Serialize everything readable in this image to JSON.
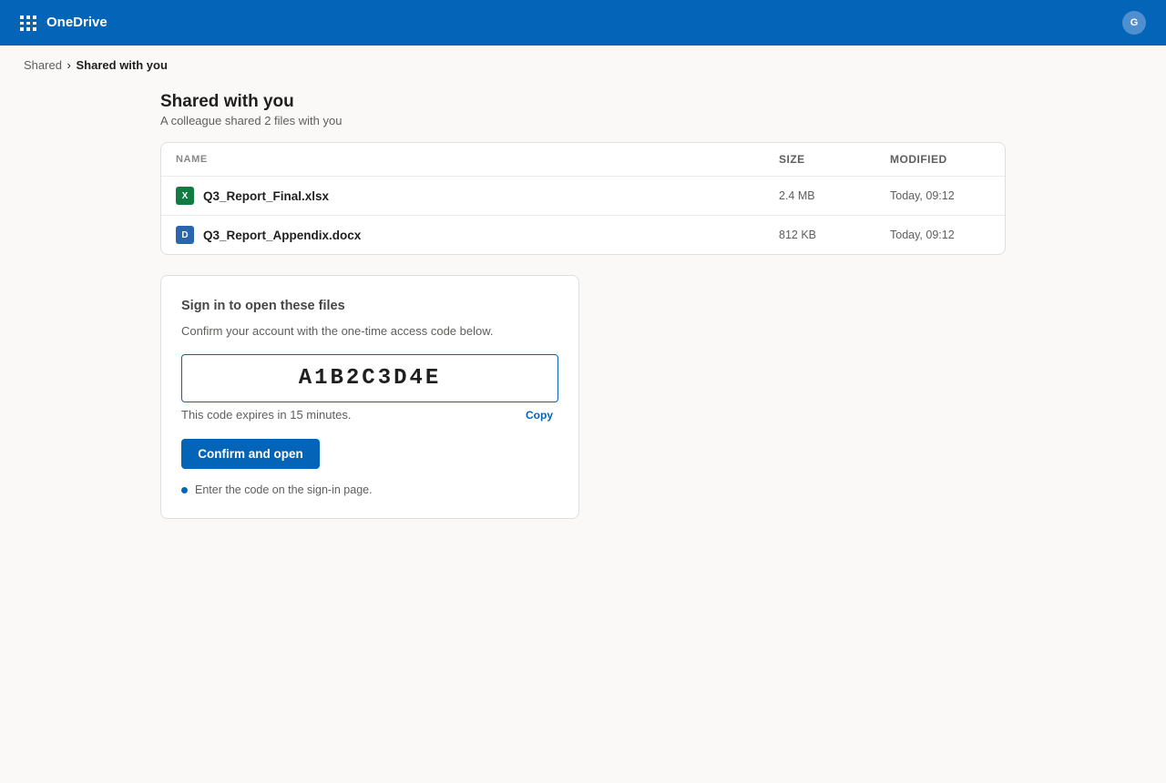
{
  "app": {
    "name": "OneDrive",
    "waffle_icon": "app-launcher-icon",
    "brand_color": "#0364b8"
  },
  "user": {
    "initial": "G"
  },
  "breadcrumb": {
    "parent": "Shared",
    "separator": "›",
    "current": "Shared with you"
  },
  "page": {
    "title": "Shared with you",
    "subtitle": "A colleague shared 2 files with you"
  },
  "table": {
    "headers": {
      "name": "NAME",
      "size": "SIZE",
      "modified": "MODIFIED"
    },
    "rows": [
      {
        "icon_letter": "X",
        "icon_name": "excel-file-icon",
        "icon_color": "#107c41",
        "name": "Q3_Report_Final.xlsx",
        "size": "2.4 MB",
        "modified": "Today, 09:12"
      },
      {
        "icon_letter": "D",
        "icon_name": "word-file-icon",
        "icon_color": "#2b65ad",
        "name": "Q3_Report_Appendix.docx",
        "size": "812 KB",
        "modified": "Today, 09:12"
      }
    ]
  },
  "signin": {
    "title": "Sign in to open these files",
    "description": "Confirm your account with the one-time access code below.",
    "code": "A1B2C3D4E",
    "expiry": "This code expires in 15 minutes.",
    "copy_label": "Copy",
    "confirm_label": "Confirm and open",
    "hint": "Enter the code on the sign-in page."
  }
}
